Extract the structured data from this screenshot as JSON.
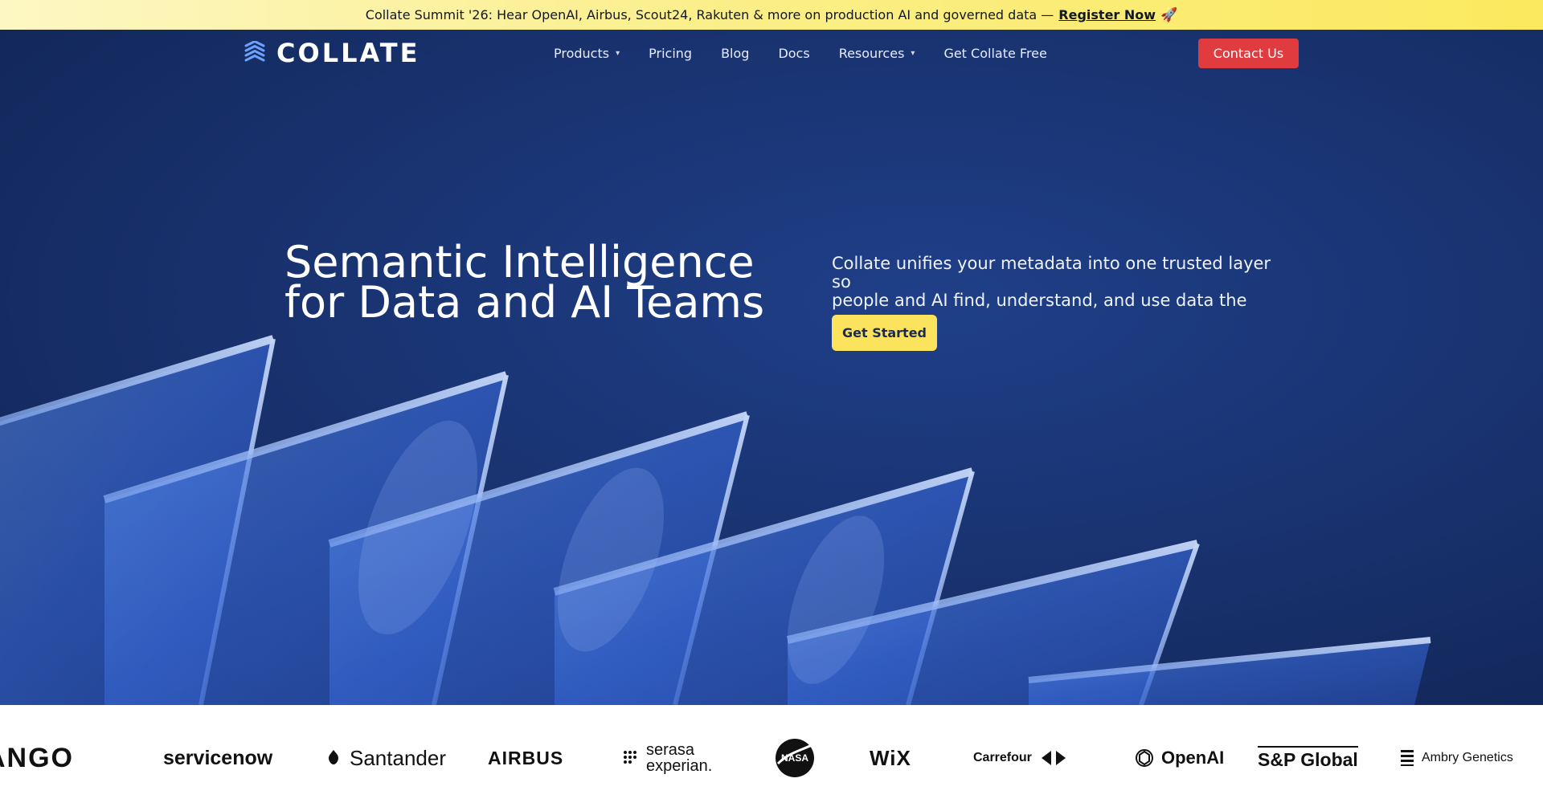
{
  "announcement": {
    "text": "Collate Summit '26: Hear OpenAI, Airbus, Scout24, Rakuten & more on production AI and governed data —",
    "link_label": "Register Now",
    "emoji": "🚀"
  },
  "nav": {
    "logo_text": "COLLATE",
    "items": [
      {
        "label": "Products"
      },
      {
        "label": "Pricing"
      },
      {
        "label": "Blog"
      },
      {
        "label": "Docs"
      },
      {
        "label": "Resources"
      },
      {
        "label": "Get Collate Free"
      }
    ],
    "contact_label": "Contact Us"
  },
  "hero": {
    "headline_line1": "Semantic Intelligence",
    "headline_line2": "for Data and AI Teams",
    "sub_line1": "Collate unifies your metadata into one trusted layer so",
    "sub_line2": "people and AI find, understand, and use data the same way.",
    "cta_label": "Get Started"
  },
  "logos": [
    {
      "name": "ANGO"
    },
    {
      "name": "servicenow"
    },
    {
      "name": "Santander"
    },
    {
      "name": "AIRBUS"
    },
    {
      "name1": "serasa",
      "name2": "experian."
    },
    {
      "name": "NASA"
    },
    {
      "name": "WiX"
    },
    {
      "name": "Carrefour"
    },
    {
      "name": "OpenAI"
    },
    {
      "name": "S&P Global"
    },
    {
      "name": "Ambry Genetics"
    }
  ],
  "colors": {
    "announce_start": "#fdf7c4",
    "announce_end": "#fbe95f",
    "hero_deep": "#112657",
    "contact": "#e03b3e",
    "cta": "#fbe35d",
    "logo_blue": "#6ea2ff"
  },
  "icons": {
    "chevron": "chevron-down-icon",
    "logo": "collate-logo-icon",
    "rocket": "rocket-icon",
    "santander_flame": "flame-icon",
    "nasa": "nasa-icon",
    "carrefour": "carrefour-icon",
    "openai": "openai-icon",
    "ambry": "ambry-icon"
  }
}
